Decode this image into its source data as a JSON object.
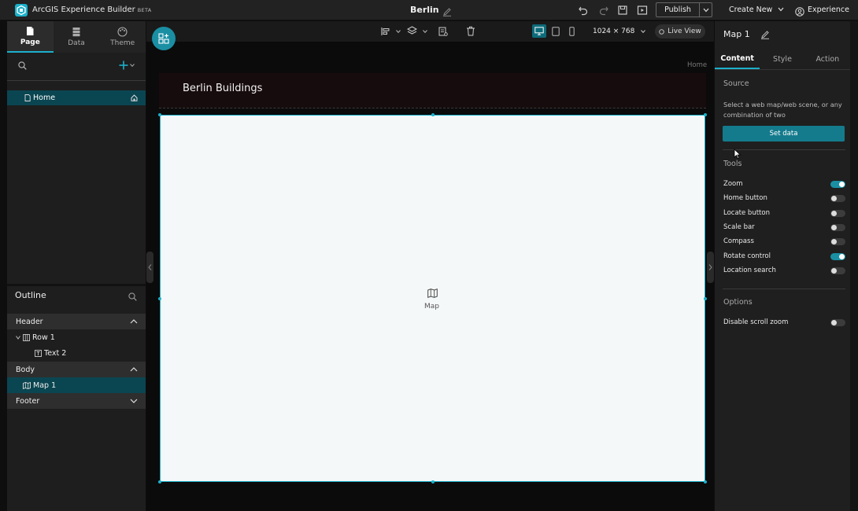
{
  "topbar": {
    "app_name": "ArcGIS Experience Builder",
    "beta_label": "BETA",
    "project_name": "Berlin",
    "publish_label": "Publish",
    "create_new_label": "Create New",
    "experience_label": "Experience"
  },
  "left": {
    "tabs": [
      {
        "label": "Page",
        "icon": "page-icon",
        "active": true
      },
      {
        "label": "Data",
        "icon": "data-icon"
      },
      {
        "label": "Theme",
        "icon": "theme-icon"
      }
    ],
    "pages": [
      {
        "label": "Home",
        "icon": "page-icon",
        "home": true
      }
    ],
    "outline_title": "Outline",
    "outline": {
      "header": {
        "label": "Header"
      },
      "row1": {
        "label": "Row 1"
      },
      "text2": {
        "label": "Text 2"
      },
      "body": {
        "label": "Body"
      },
      "map1": {
        "label": "Map 1"
      },
      "footer": {
        "label": "Footer"
      }
    }
  },
  "canvas": {
    "resolution": "1024 × 768",
    "live_view_label": "Live View",
    "breadcrumb": "Home",
    "header_title": "Berlin Buildings",
    "map_label": "Map"
  },
  "right": {
    "widget_title": "Map 1",
    "tabs": [
      {
        "label": "Content",
        "active": true
      },
      {
        "label": "Style"
      },
      {
        "label": "Action"
      }
    ],
    "source_title": "Source",
    "source_desc": "Select a web map/web scene, or any combination of two",
    "set_data_label": "Set data",
    "tools_title": "Tools",
    "tools": [
      {
        "label": "Zoom",
        "on": true
      },
      {
        "label": "Home button",
        "on": false
      },
      {
        "label": "Locate button",
        "on": false
      },
      {
        "label": "Scale bar",
        "on": false
      },
      {
        "label": "Compass",
        "on": false
      },
      {
        "label": "Rotate control",
        "on": true
      },
      {
        "label": "Location search",
        "on": false
      }
    ],
    "options_title": "Options",
    "options": [
      {
        "label": "Disable scroll zoom",
        "on": false
      }
    ]
  },
  "colors": {
    "accent": "#1bb0c9",
    "selected_row": "#0a4651",
    "primary_button": "#147b8d"
  }
}
